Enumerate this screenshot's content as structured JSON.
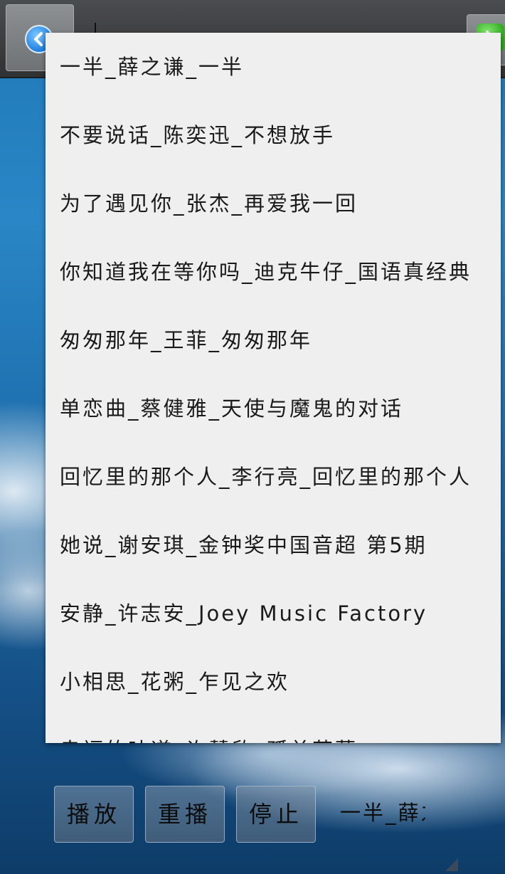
{
  "songs": [
    "一半_薛之谦_一半",
    "不要说话_陈奕迅_不想放手",
    "为了遇见你_张杰_再爱我一回",
    "你知道我在等你吗_迪克牛仔_国语真经典",
    "匆匆那年_王菲_匆匆那年",
    "单恋曲_蔡健雅_天使与魔鬼的对话",
    "回忆里的那个人_李行亮_回忆里的那个人",
    "她说_谢安琪_金钟奖中国音超 第5期",
    "安静_许志安_Joey Music Factory",
    "小相思_花粥_乍见之欢",
    "幸福的味道_许慧欣_孤单芭蕾"
  ],
  "controls": {
    "play_label": "播放",
    "replay_label": "重播",
    "stop_label": "停止"
  },
  "now_playing": "一半_薛之谦_一半",
  "icons": {
    "back": "back-arrow-icon",
    "next": "next-arrow-icon"
  },
  "colors": {
    "panel_bg": "#efefef",
    "back_icon": "#1f7fe0",
    "next_icon": "#2ea51f"
  }
}
